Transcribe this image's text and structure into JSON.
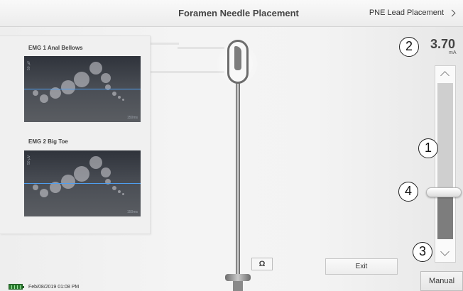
{
  "header": {
    "title": "Foramen Needle Placement",
    "next_label": "PNE Lead Placement"
  },
  "emg_channels": [
    {
      "label": "EMG 1  Anal Bellows",
      "unit": "50 µV",
      "time": "150ms"
    },
    {
      "label": "EMG 2  Big Toe",
      "unit": "50 µV",
      "time": "150ms"
    }
  ],
  "stimulation": {
    "amplitude": "3.70",
    "unit": "mA",
    "level_fraction": 0.3
  },
  "callouts": {
    "c1": "1",
    "c2": "2",
    "c3": "3",
    "c4": "4"
  },
  "buttons": {
    "impedance": "Ω",
    "exit": "Exit",
    "manual": "Manual"
  },
  "footer": {
    "datetime": "Feb/08/2019 01:08 PM"
  },
  "icons": {
    "next": "chevron-right-icon",
    "up": "chevron-up-icon",
    "down": "chevron-down-icon",
    "battery": "battery-icon"
  },
  "colors": {
    "baseline": "#4f9ef0",
    "battery": "#2e7d32"
  }
}
